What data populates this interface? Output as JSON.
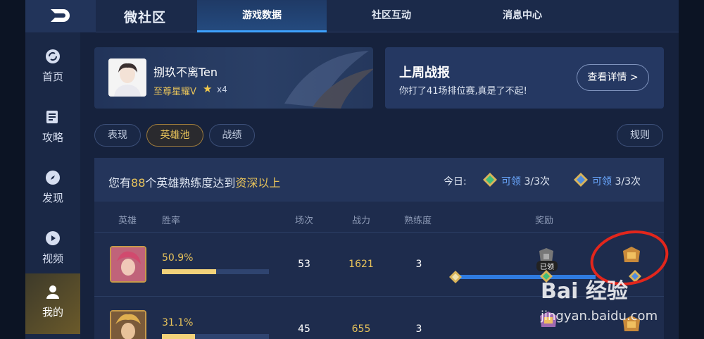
{
  "topbar": {
    "app_title": "微社区",
    "tabs": [
      {
        "label": "游戏数据",
        "active": true
      },
      {
        "label": "社区互动",
        "active": false
      },
      {
        "label": "消息中心",
        "active": false
      }
    ]
  },
  "sidebar": {
    "items": [
      {
        "label": "首页",
        "icon": "refresh-icon",
        "active": false
      },
      {
        "label": "攻略",
        "icon": "guide-icon",
        "active": false
      },
      {
        "label": "发现",
        "icon": "compass-icon",
        "active": false
      },
      {
        "label": "视频",
        "icon": "play-icon",
        "active": false
      },
      {
        "label": "我的",
        "icon": "user-icon",
        "active": true
      }
    ]
  },
  "profile": {
    "name": "捌玖不离Ten",
    "rank": "至尊星耀V",
    "stars": "x4"
  },
  "weekly_report": {
    "title": "上周战报",
    "subtitle": "你打了41场排位赛,真是了不起!",
    "button": "查看详情 >"
  },
  "filters": {
    "items": [
      "表现",
      "英雄池",
      "战绩"
    ],
    "active": "英雄池",
    "rules": "规则"
  },
  "summary": {
    "prefix": "您有",
    "count": "88",
    "middle": "个英雄熟练度达到",
    "level": "资深以上",
    "today_label": "今日:",
    "claim1_label": "可领",
    "claim1_count": "3/3次",
    "claim2_label": "可领",
    "claim2_count": "3/3次"
  },
  "table": {
    "headers": {
      "hero": "英雄",
      "winrate": "胜率",
      "matches": "场次",
      "power": "战力",
      "mastery": "熟练度",
      "reward": "奖励"
    },
    "rows": [
      {
        "winrate": "50.9%",
        "winrate_value": 0.509,
        "matches": "53",
        "power": "1621",
        "mastery": "3",
        "claimed_label": "已领"
      },
      {
        "winrate": "31.1%",
        "winrate_value": 0.311,
        "matches": "45",
        "power": "655",
        "mastery": "3"
      }
    ]
  },
  "watermark": {
    "brand": "Bai 经验",
    "url": "jingyan.baidu.com"
  },
  "colors": {
    "accent_blue": "#3ea1ff",
    "gold": "#e8c35a",
    "annotation_red": "#e2261c"
  }
}
